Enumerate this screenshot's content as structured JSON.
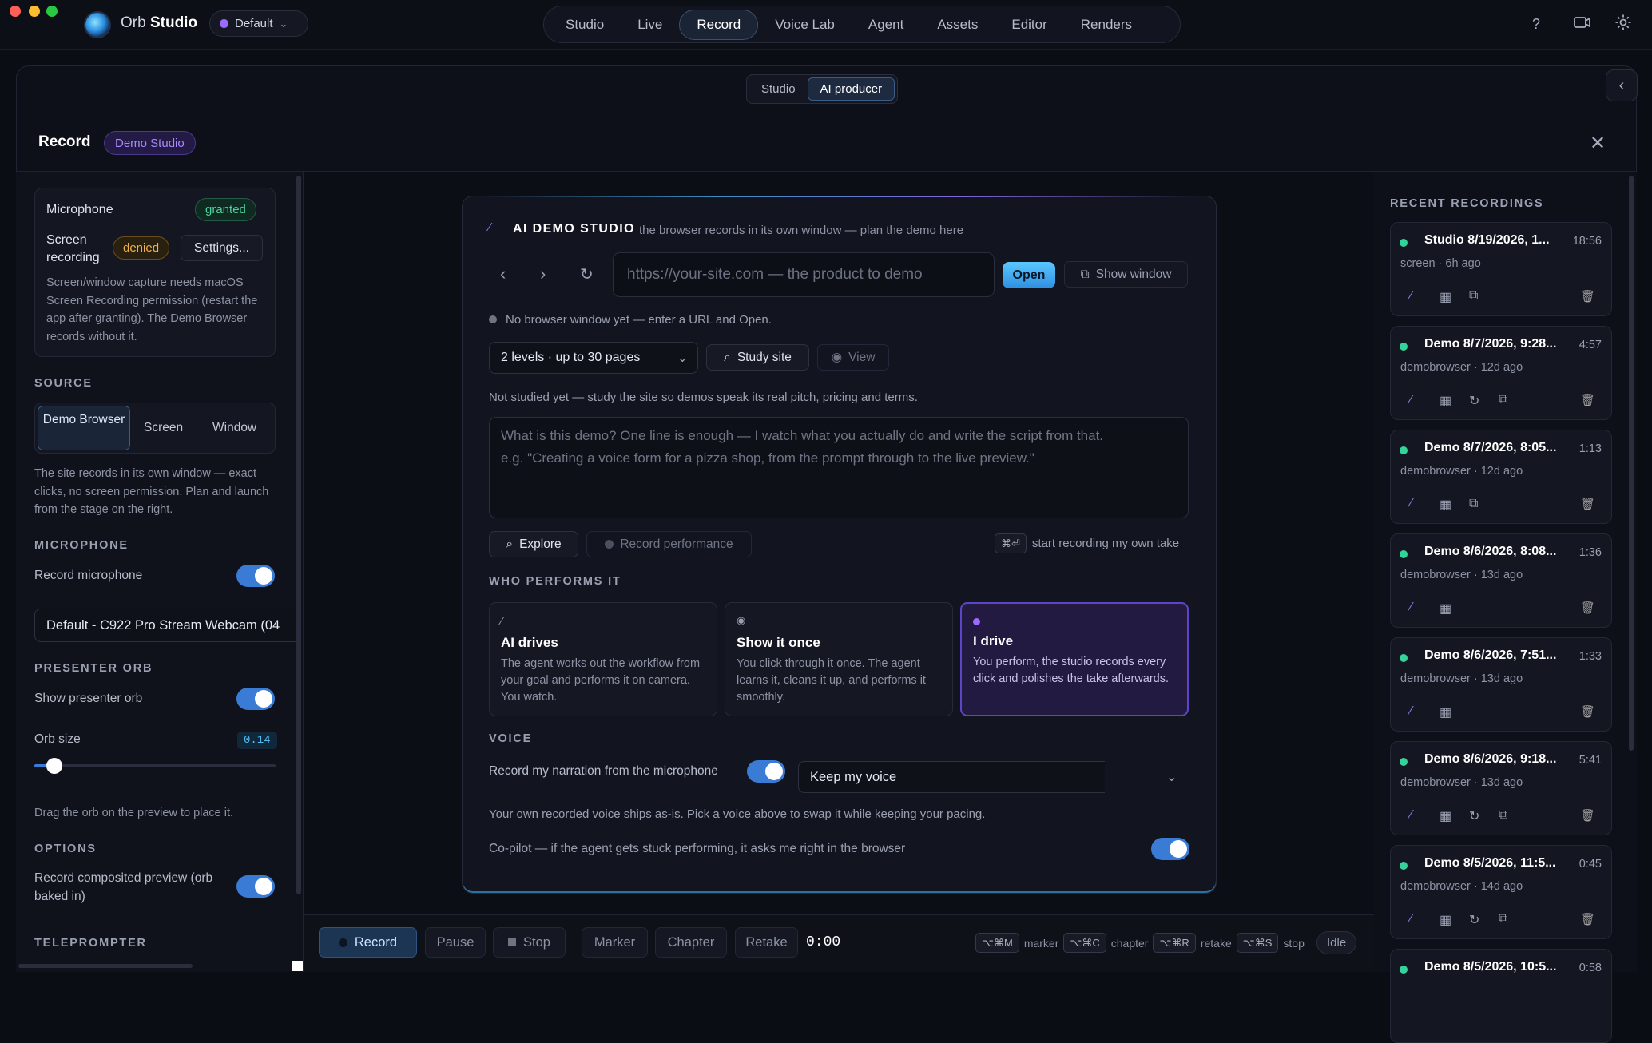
{
  "app": {
    "name_a": "Orb",
    "name_b": "Studio",
    "profile": "Default"
  },
  "nav": {
    "tabs": [
      "Studio",
      "Live",
      "Record",
      "Voice Lab",
      "Agent",
      "Assets",
      "Editor",
      "Renders"
    ],
    "active": "Record"
  },
  "mode_switch": {
    "options": [
      "Studio",
      "AI producer"
    ],
    "active": "AI producer"
  },
  "header": {
    "title": "Record",
    "badge": "Demo Studio"
  },
  "permissions": {
    "microphone_label": "Microphone",
    "microphone_status": "granted",
    "screen_label": "Screen recording",
    "screen_status": "denied",
    "settings_button": "Settings...",
    "note": "Screen/window capture needs macOS Screen Recording permission (restart the app after granting). The Demo Browser records without it."
  },
  "source": {
    "heading": "SOURCE",
    "options": [
      "Demo Browser",
      "Screen",
      "Window"
    ],
    "active": "Demo Browser",
    "note": "The site records in its own window — exact clicks, no screen permission. Plan and launch from the stage on the right."
  },
  "microphone": {
    "heading": "MICROPHONE",
    "record_label": "Record microphone",
    "device": "Default - C922 Pro Stream Webcam (04"
  },
  "presenter": {
    "heading": "PRESENTER ORB",
    "show_label": "Show presenter orb",
    "size_label": "Orb size",
    "size_value": "0.14",
    "size_fraction": 0.14,
    "hint": "Drag the orb on the preview to place it."
  },
  "options": {
    "heading": "OPTIONS",
    "composited_label": "Record composited preview (orb baked in)"
  },
  "teleprompter": {
    "heading": "TELEPROMPTER"
  },
  "studio": {
    "title": "AI DEMO STUDIO",
    "subtitle": "the browser records in its own window — plan the demo here",
    "url_placeholder": "https://your-site.com — the product to demo",
    "open_button": "Open",
    "show_window_button": "Show window",
    "status": "No browser window yet — enter a URL and Open.",
    "depth": "2 levels · up to 30 pages",
    "study_button": "Study site",
    "view_button": "View",
    "study_note": "Not studied yet — study the site so demos speak its real pitch, pricing and terms.",
    "goal_placeholder": "What is this demo? One line is enough — I watch what you actually do and write the script from that.\ne.g. \"Creating a voice form for a pizza shop, from the prompt through to the live preview.\"",
    "explore_button": "Explore",
    "record_perf_button": "Record performance",
    "shortcut_hint": "start recording my own take",
    "shortcut_key": "⌘⏎",
    "who_heading": "WHO PERFORMS IT",
    "performers": [
      {
        "title": "AI drives",
        "desc": "The agent works out the workflow from your goal and performs it on camera. You watch.",
        "icon": "wand-icon"
      },
      {
        "title": "Show it once",
        "desc": "You click through it once. The agent learns it, cleans it up, and performs it smoothly.",
        "icon": "eye-icon"
      },
      {
        "title": "I drive",
        "desc": "You perform, the studio records every click and polishes the take afterwards.",
        "icon": "dot-icon"
      }
    ],
    "selected_performer": "I drive",
    "voice_heading": "VOICE",
    "narration_label": "Record my narration from the microphone",
    "voice_choice": "Keep my voice",
    "voice_note": "Your own recorded voice ships as-is. Pick a voice above to swap it while keeping your pacing.",
    "copilot_label": "Co-pilot — if the agent gets stuck performing, it asks me right in the browser"
  },
  "transport": {
    "record": "Record",
    "pause": "Pause",
    "stop": "Stop",
    "marker": "Marker",
    "chapter": "Chapter",
    "retake": "Retake",
    "time": "0:00",
    "shortcuts": [
      {
        "key": "⌥⌘M",
        "label": "marker"
      },
      {
        "key": "⌥⌘C",
        "label": "chapter"
      },
      {
        "key": "⌥⌘R",
        "label": "retake"
      },
      {
        "key": "⌥⌘S",
        "label": "stop"
      }
    ],
    "state": "Idle"
  },
  "recent": {
    "heading": "RECENT RECORDINGS",
    "items": [
      {
        "name": "Studio 8/19/2026, 1...",
        "duration": "18:56",
        "meta": "screen · 6h ago",
        "icons": [
          "wand-icon",
          "film-icon",
          "external-link-icon"
        ]
      },
      {
        "name": "Demo 8/7/2026, 9:28...",
        "duration": "4:57",
        "meta": "demobrowser · 12d ago",
        "icons": [
          "wand-icon",
          "film-icon",
          "refresh-icon",
          "external-link-icon"
        ]
      },
      {
        "name": "Demo 8/7/2026, 8:05...",
        "duration": "1:13",
        "meta": "demobrowser · 12d ago",
        "icons": [
          "wand-icon",
          "film-icon",
          "external-link-icon"
        ]
      },
      {
        "name": "Demo 8/6/2026, 8:08...",
        "duration": "1:36",
        "meta": "demobrowser · 13d ago",
        "icons": [
          "wand-icon",
          "film-icon"
        ]
      },
      {
        "name": "Demo 8/6/2026, 7:51...",
        "duration": "1:33",
        "meta": "demobrowser · 13d ago",
        "icons": [
          "wand-icon",
          "film-icon"
        ]
      },
      {
        "name": "Demo 8/6/2026, 9:18...",
        "duration": "5:41",
        "meta": "demobrowser · 13d ago",
        "icons": [
          "wand-icon",
          "film-icon",
          "refresh-icon",
          "external-link-icon"
        ]
      },
      {
        "name": "Demo 8/5/2026, 11:5...",
        "duration": "0:45",
        "meta": "demobrowser · 14d ago",
        "icons": [
          "wand-icon",
          "film-icon",
          "refresh-icon",
          "external-link-icon"
        ]
      },
      {
        "name": "Demo 8/5/2026, 10:5...",
        "duration": "0:58",
        "meta": "",
        "icons": []
      }
    ]
  },
  "colors": {
    "accent": "#3a7bd5",
    "success": "#34d399",
    "warning": "#f0b44a",
    "violet": "#a78bfa"
  }
}
